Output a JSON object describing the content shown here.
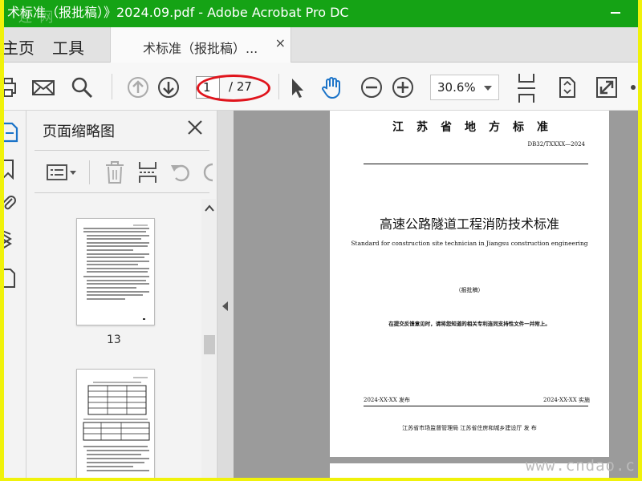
{
  "window": {
    "title": "术标准（报批稿）》2024.09.pdf - Adobe Acrobat Pro DC",
    "watermark": "连 网"
  },
  "menu": {
    "home_label": "主页",
    "tools_label": "工具"
  },
  "document_tab": {
    "label": "术标准（报批稿）...",
    "close_glyph": "×"
  },
  "toolbar": {
    "page_current": "1",
    "page_total": "/ 27",
    "zoom": "30.6%",
    "icons": [
      "print-icon",
      "mail-icon",
      "search-icon",
      "prev-page-icon",
      "next-page-icon",
      "select-arrow-icon",
      "hand-tool-icon",
      "zoom-out-icon",
      "zoom-in-icon",
      "scroll-mode-icon",
      "fit-page-icon",
      "fullscreen-icon"
    ]
  },
  "thumbnail_pane": {
    "title": "页面缩略图",
    "thumbnails": [
      {
        "label": "13"
      },
      {
        "label": ""
      }
    ]
  },
  "page": {
    "header": "江苏省地方标准",
    "code": "DB32/TXXXX—2024",
    "title": "高速公路隧道工程消防技术标准",
    "subtitle": "Standard for construction site technician in Jiangsu construction engineering",
    "draft": "（报批稿）",
    "note": "在提交反馈意见时，请将您知道的相关专利连同支持性文件一并附上。",
    "release_date": "2024-XX-XX 发布",
    "effective_date": "2024-XX-XX 实施",
    "issuer": "江苏省市场监督管理局   江苏省住房和城乡建设厅     发  布"
  },
  "site_watermark": "www.cndao.c"
}
